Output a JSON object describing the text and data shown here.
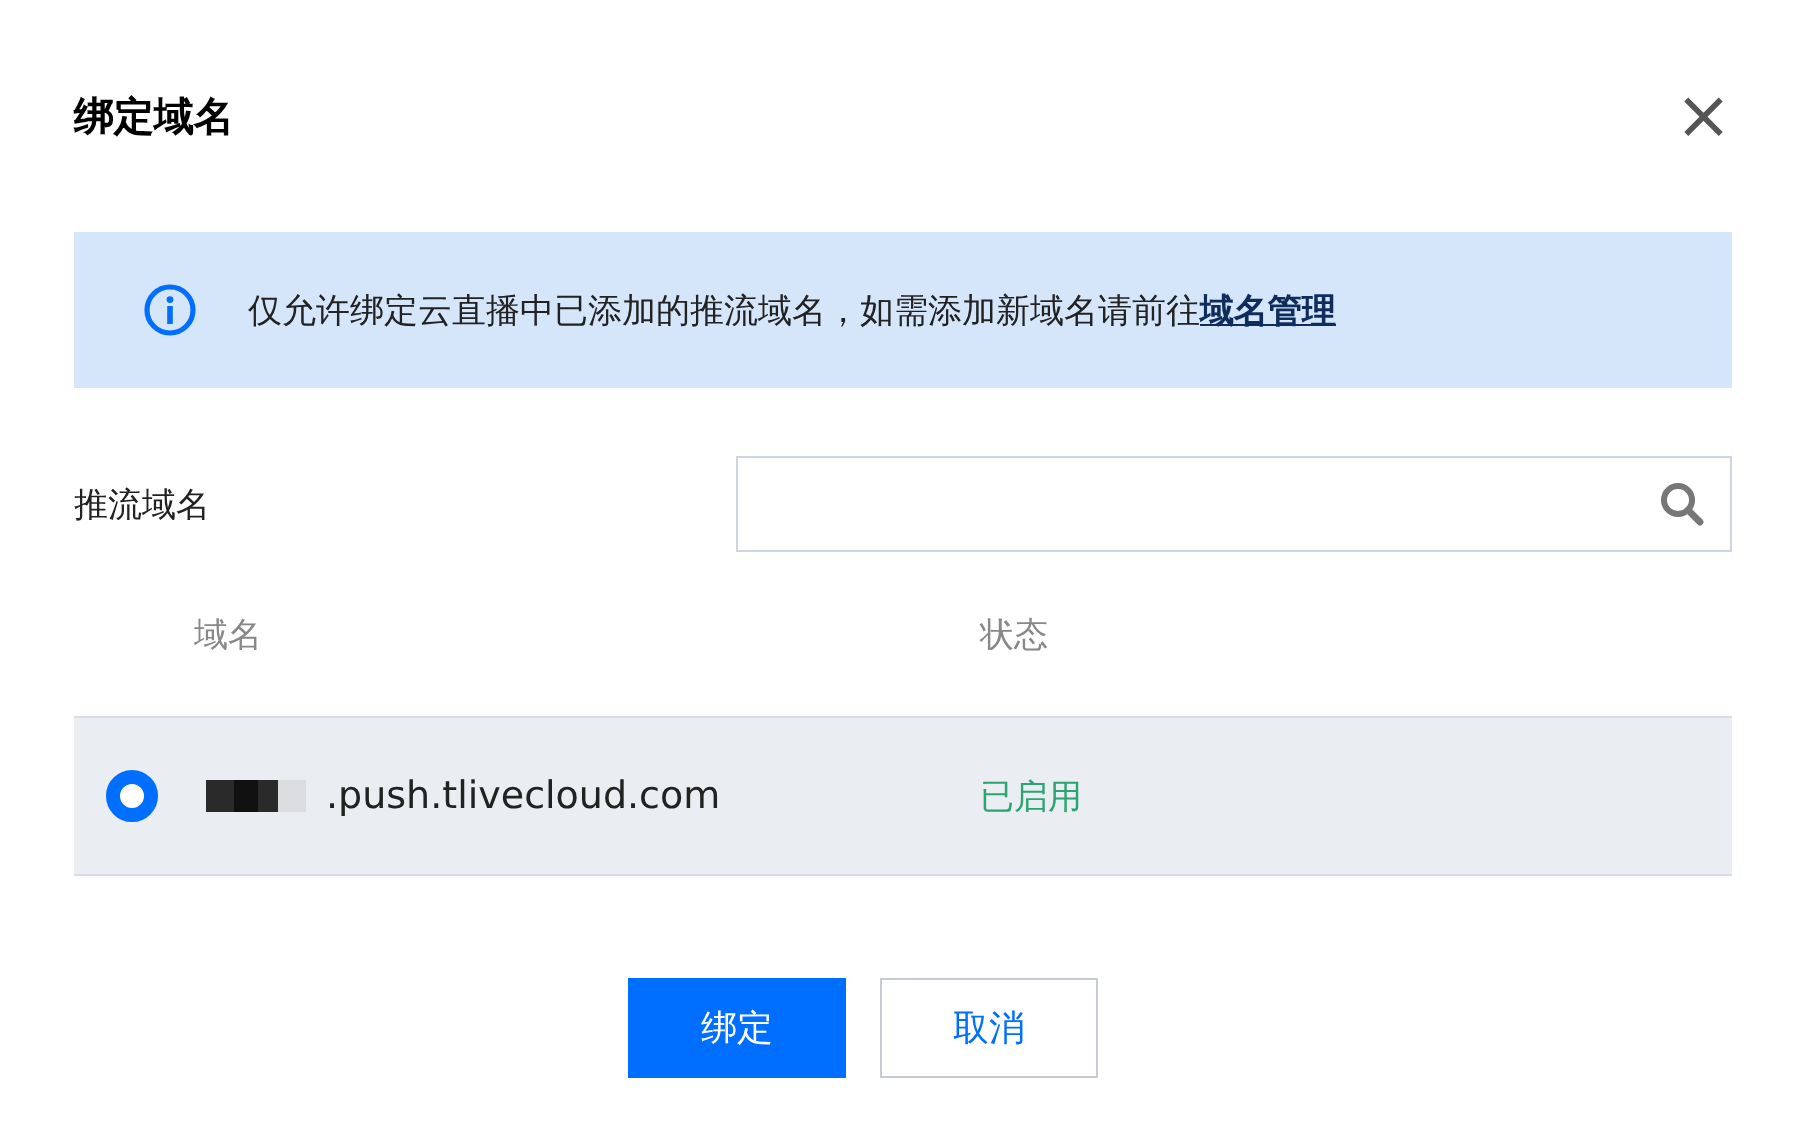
{
  "dialog": {
    "title": "绑定域名",
    "close": "×"
  },
  "notice": {
    "text": "仅允许绑定云直播中已添加的推流域名，如需添加新域名请前往",
    "link": "域名管理"
  },
  "search": {
    "label": "推流域名"
  },
  "table": {
    "columns": [
      "域名",
      "状态"
    ],
    "rows": [
      {
        "selected": true,
        "domain": ".push.tlivecloud.com",
        "status": "已启用"
      }
    ]
  },
  "buttons": [
    {
      "label": "绑定",
      "kind": "primary"
    },
    {
      "label": "取消",
      "kind": "secondary"
    }
  ]
}
